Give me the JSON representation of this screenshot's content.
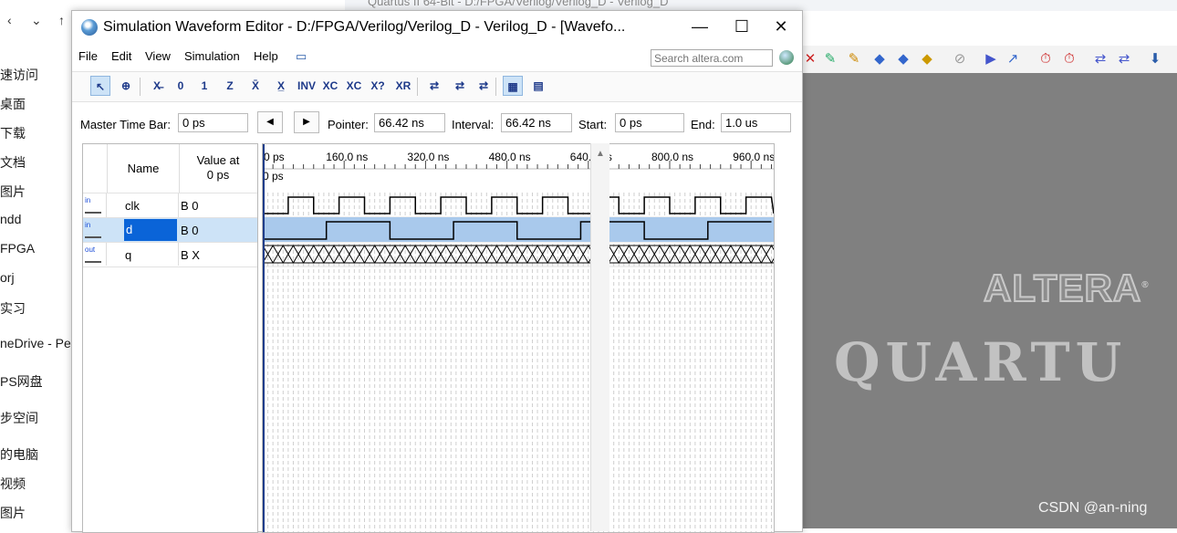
{
  "explorer": {
    "back_arrow": "‹",
    "forward_arrow": "⌄",
    "up_arrow": "↑",
    "items": [
      "速访问",
      "桌面",
      "下载",
      "文档",
      "图片",
      "ndd",
      "FPGA",
      "orj",
      "实习",
      "neDrive - Pe",
      "PS网盘",
      "步空间",
      "的电脑",
      "视频",
      "图片"
    ]
  },
  "quartus_bg": {
    "title_fragment": "Quartus II 64-Bit - D:/FPGA/Verilog/Verilog_D - Verilog_D",
    "logo_text": "ALTERA",
    "logo_mark": "®",
    "product_text": "QUARTU",
    "toolbar_icons": [
      "fitter-icon",
      "assignment-icon",
      "pin-planner-icon",
      "chip-planner-icon",
      "netlist-icon",
      "programmer-icon",
      "stop-icon",
      "start-compile-icon",
      "analysis-icon",
      "timequest-icon",
      "timer-icon",
      "rtl-viewer-icon",
      "tech-map-icon",
      "download-icon"
    ]
  },
  "watermark": "CSDN @an-ning",
  "editor": {
    "title": "Simulation Waveform Editor - D:/FPGA/Verilog/Verilog_D - Verilog_D - [Wavefo...",
    "minimize": "—",
    "maximize": "☐",
    "close": "✕",
    "menu": [
      "File",
      "Edit",
      "View",
      "Simulation",
      "Help"
    ],
    "search_placeholder": "Search altera.com",
    "toolbar": [
      "↖",
      "⊕",
      "X̶",
      "0",
      "1",
      "Z",
      "X̄",
      "X̲",
      "INV",
      "XC",
      "XC",
      "X?",
      "XR",
      "⇄",
      "⇄",
      "⇄",
      "▦",
      "▤"
    ],
    "timebar": {
      "master_label": "Master Time Bar:",
      "master_value": "0 ps",
      "prev_btn": "◀",
      "next_btn": "▶",
      "pointer_label": "Pointer:",
      "pointer_value": "66.42 ns",
      "interval_label": "Interval:",
      "interval_value": "66.42 ns",
      "start_label": "Start:",
      "start_value": "0 ps",
      "end_label": "End:",
      "end_value": "1.0 us"
    },
    "columns": {
      "name": "Name",
      "value_line1": "Value at",
      "value_line2": "0 ps"
    },
    "signals": [
      {
        "type": "in",
        "name": "clk",
        "value": "B 0"
      },
      {
        "type": "in",
        "name": "d",
        "value": "B 0"
      },
      {
        "type": "out",
        "name": "q",
        "value": "B X"
      }
    ],
    "time_ticks": [
      "0 ps",
      "160.0 ns",
      "320.0 ns",
      "480.0 ns",
      "640.0 ns",
      "800.0 ns",
      "960.0 ns"
    ],
    "cursor_label": "0 ps"
  },
  "waveform": {
    "time_end_ns": 1000,
    "clk_period_ns": 100,
    "clk_first_rise_ns": 50,
    "d_edges_ns": [
      [
        125,
        250
      ],
      [
        375,
        500
      ],
      [
        625,
        750
      ],
      [
        875,
        1000
      ]
    ],
    "q_value": "X"
  }
}
